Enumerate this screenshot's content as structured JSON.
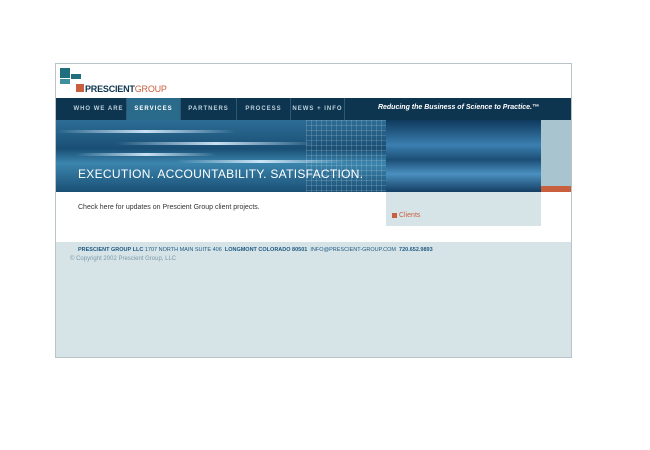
{
  "logo": {
    "brand_primary": "PRESCIENT",
    "brand_secondary": "GROUP"
  },
  "nav": {
    "items": [
      {
        "label": "WHO WE ARE",
        "active": false
      },
      {
        "label": "SERVICES",
        "active": true
      },
      {
        "label": "PARTNERS",
        "active": false
      },
      {
        "label": "PROCESS",
        "active": false
      },
      {
        "label": "NEWS + INFO",
        "active": false
      }
    ],
    "tagline": "Reducing the Business of Science to Practice.™"
  },
  "banner": {
    "slogan": "EXECUTION. ACCOUNTABILITY. SATISFACTION."
  },
  "content": {
    "intro": "Check here for updates on Prescient Group client projects.",
    "sidebar_link": "Clients"
  },
  "footer": {
    "company": "PRESCIENT GROUP LLC",
    "street": "1707 NORTH MAIN SUITE 406",
    "city": "LONGMONT COLORADO 80501",
    "email": "INFO@PRESCIENT-GROUP.COM",
    "phone": "720.652.9893",
    "copyright": "© Copyright 2002 Prescient Group, LLC"
  },
  "colors": {
    "navy": "#0e3550",
    "accent_orange": "#c86040",
    "page_bg": "#d6e4e8",
    "teal": "#1f6f7f"
  }
}
